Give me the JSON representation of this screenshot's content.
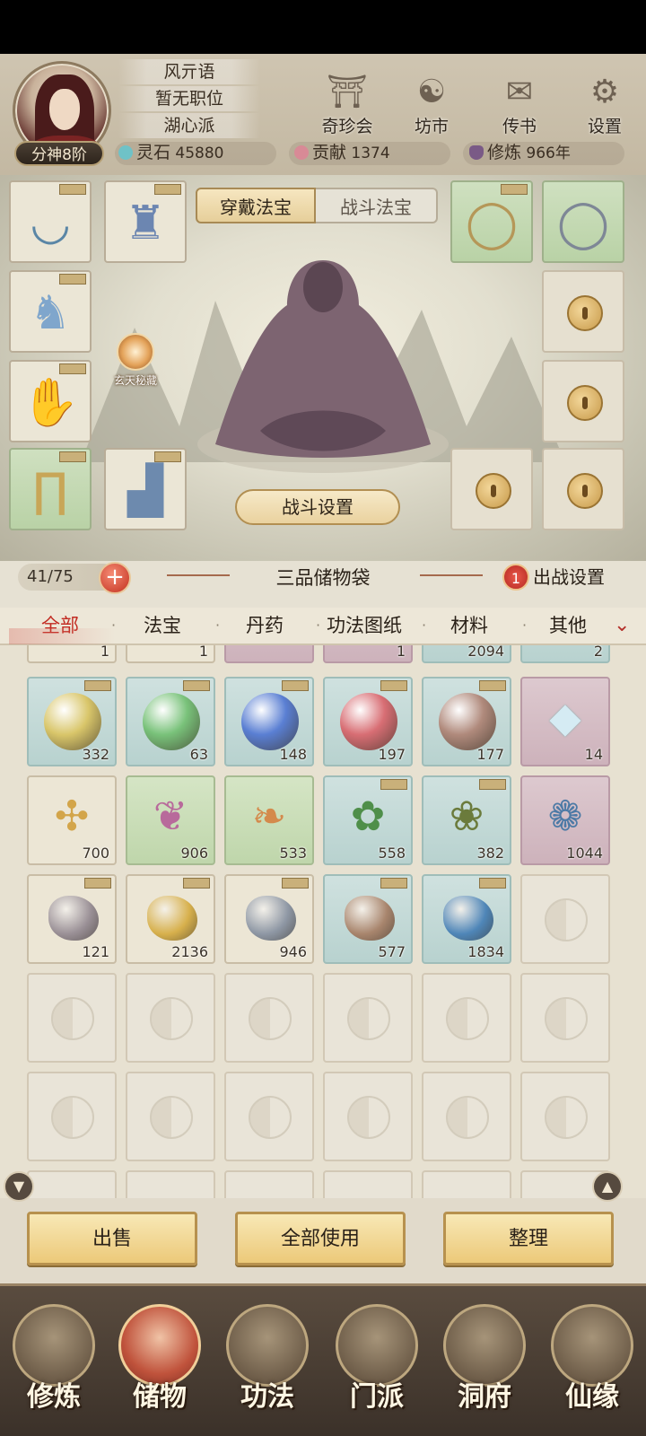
{
  "player": {
    "name": "风亓语",
    "position": "暂无职位",
    "sect": "湖心派",
    "rank": "分神8阶"
  },
  "top_buttons": [
    {
      "label": "奇珍会",
      "icon": "pavilion-icon"
    },
    {
      "label": "坊市",
      "icon": "market-icon"
    },
    {
      "label": "传书",
      "icon": "scroll-icon"
    },
    {
      "label": "设置",
      "icon": "gear-icon"
    }
  ],
  "resources": {
    "lingshi_label": "灵石",
    "lingshi_value": "45880",
    "gongxian_label": "贡献",
    "gongxian_value": "1374",
    "xiulian_label": "修炼",
    "xiulian_value": "966年"
  },
  "equip_tabs": {
    "wear": "穿戴法宝",
    "battle": "战斗法宝"
  },
  "xuantian_label": "玄天秘藏",
  "battle_settings": "战斗设置",
  "bag": {
    "capacity": "41/75",
    "title": "三品储物袋",
    "dispatch_count": "1",
    "dispatch_label": "出战设置"
  },
  "filters": [
    "全部",
    "法宝",
    "丹药",
    "功法图纸",
    "材料",
    "其他"
  ],
  "partial_counts": [
    "1",
    "1",
    "1",
    "2094",
    "2"
  ],
  "items_row1": [
    {
      "count": "332",
      "color": "#d9c66a"
    },
    {
      "count": "63",
      "color": "#79c27a"
    },
    {
      "count": "148",
      "color": "#5a7fd3"
    },
    {
      "count": "197",
      "color": "#d86e74"
    },
    {
      "count": "177",
      "color": "#b08a7c"
    },
    {
      "count": "14",
      "color": "#cfe4ee"
    }
  ],
  "items_row2": [
    {
      "count": "700",
      "icon": "ginseng-root-icon"
    },
    {
      "count": "906",
      "icon": "purple-root-icon"
    },
    {
      "count": "533",
      "icon": "orange-root-icon"
    },
    {
      "count": "558",
      "icon": "white-flower-icon"
    },
    {
      "count": "382",
      "icon": "red-berry-herb-icon"
    },
    {
      "count": "1044",
      "icon": "blue-berry-branch-icon"
    }
  ],
  "items_row3": [
    {
      "count": "121",
      "color": "#9a9096"
    },
    {
      "count": "2136",
      "color": "#d7b04c"
    },
    {
      "count": "946",
      "color": "#8e97a4"
    },
    {
      "count": "577",
      "color": "#a8856d"
    },
    {
      "count": "1834",
      "color": "#4f86b8"
    }
  ],
  "actions": {
    "sell": "出售",
    "use_all": "全部使用",
    "sort": "整理"
  },
  "nav": [
    "修炼",
    "储物",
    "功法",
    "门派",
    "洞府",
    "仙缘"
  ]
}
